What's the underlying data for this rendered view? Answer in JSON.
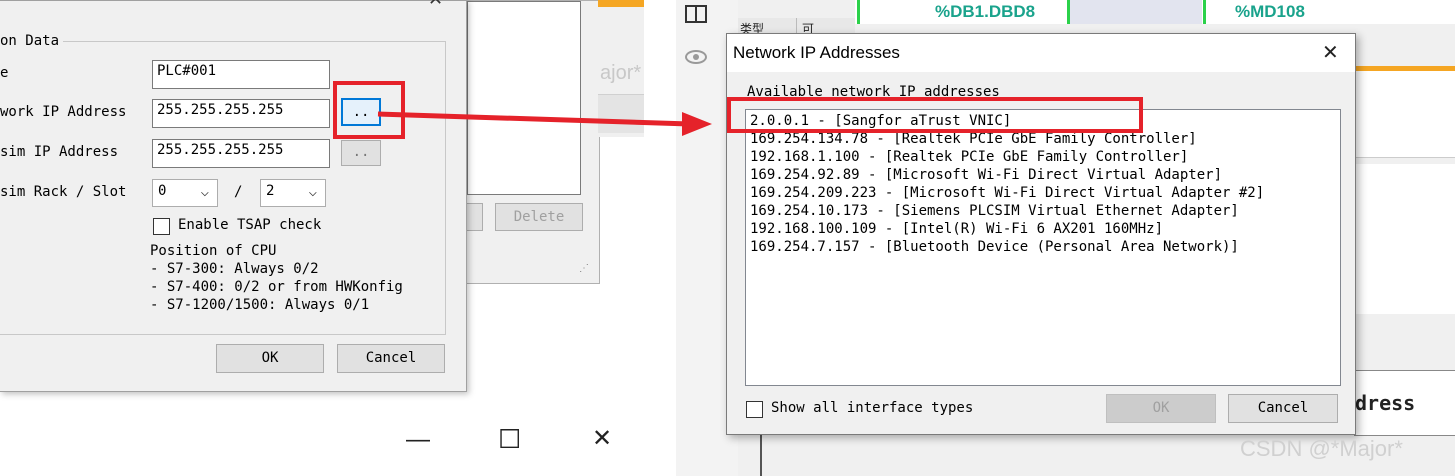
{
  "left": {
    "group_title": "on Data",
    "labels": {
      "name": "e",
      "network_ip": "work IP Address",
      "plcsim_ip": "sim IP Address",
      "rack_slot": "sim Rack / Slot"
    },
    "fields": {
      "name_value": "PLC#001",
      "network_ip_value": "255.255.255.255",
      "plcsim_ip_value": "255.255.255.255"
    },
    "browse_label": "..",
    "rack_value": "0",
    "slot_separator": "/",
    "slot_value": "2",
    "tsap_label": "Enable TSAP check",
    "position_title": "Position of CPU",
    "position_lines": [
      "- S7-300: Always 0/2",
      "- S7-400: 0/2 or from HWKonfig",
      "- S7-1200/1500: Always 0/1"
    ],
    "ok_label": "OK",
    "cancel_label": "Cancel",
    "close_glyph": "✕"
  },
  "back_window": {
    "delete_label": "Delete",
    "major_text": "ajor*"
  },
  "bottom_bar": {
    "minimize": "—",
    "maximize": "☐",
    "close": "✕"
  },
  "top_strip": {
    "tab_a": "类型",
    "tab_b": "可",
    "cell_db": "%DB1.DBD8",
    "cell_md": "%MD108"
  },
  "net_dialog": {
    "title": "Network IP Addresses",
    "close_glyph": "✕",
    "group_label": "Available network IP addresses",
    "items": [
      "2.0.0.1 - [Sangfor aTrust VNIC]",
      "169.254.134.78 - [Realtek PCIe GbE Family Controller]",
      "192.168.1.100 - [Realtek PCIe GbE Family Controller]",
      "169.254.92.89 - [Microsoft Wi-Fi Direct Virtual Adapter]",
      "169.254.209.223 - [Microsoft Wi-Fi Direct Virtual Adapter #2]",
      "169.254.10.173 - [Siemens PLCSIM Virtual Ethernet Adapter]",
      "192.168.100.109 - [Intel(R) Wi-Fi 6 AX201 160MHz]",
      "169.254.7.157 - [Bluetooth Device (Personal Area Network)]"
    ],
    "show_all_label": "Show all interface types",
    "ok_label": "OK",
    "cancel_label": "Cancel"
  },
  "right_bg": {
    "dress_text": "dress"
  },
  "watermark": "CSDN @*Major*",
  "colors": {
    "highlight_red": "#e5222a",
    "teal_text": "#1aa38c",
    "orange_line": "#f5a623",
    "green_line": "#2bd14a"
  }
}
